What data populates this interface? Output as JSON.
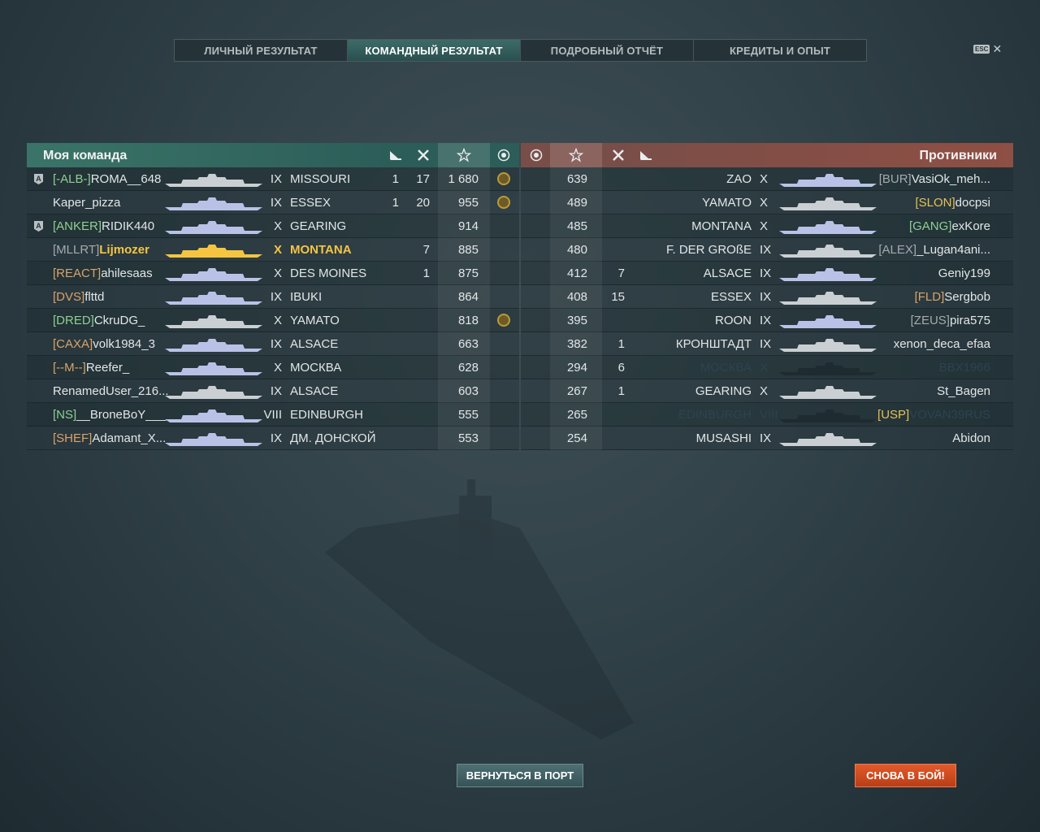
{
  "tabs": [
    "ЛИЧНЫЙ РЕЗУЛЬТАТ",
    "КОМАНДНЫЙ РЕЗУЛЬТАТ",
    "ПОДРОБНЫЙ ОТЧЁТ",
    "КРЕДИТЫ И ОПЫТ"
  ],
  "active_tab": 1,
  "esc": {
    "key": "ESC",
    "close": "✕"
  },
  "my_team": {
    "title": "Моя команда",
    "rows": [
      {
        "clan": "[-ALB-]",
        "name": "ROMA__648",
        "tier": "IX",
        "ship": "MISSOURI",
        "planes": "1",
        "kills": "17",
        "score": "1 680",
        "medal": true,
        "badge": true,
        "clan_color": "green"
      },
      {
        "clan": "",
        "name": "Kaper_pizza",
        "tier": "IX",
        "ship": "ESSEX",
        "planes": "1",
        "kills": "20",
        "score": "955",
        "medal": true,
        "badge": false,
        "clan_color": ""
      },
      {
        "clan": "[ANKER]",
        "name": "RIDIK440",
        "tier": "X",
        "ship": "GEARING",
        "planes": "",
        "kills": "",
        "score": "914",
        "medal": false,
        "badge": true,
        "clan_color": "green"
      },
      {
        "clan": "[MLLRT]",
        "name": "Lijmozer",
        "tier": "X",
        "ship": "MONTANA",
        "planes": "",
        "kills": "7",
        "score": "885",
        "medal": false,
        "badge": false,
        "clan_color": "gray",
        "me": true
      },
      {
        "clan": "[REACT]",
        "name": "ahilesaas",
        "tier": "X",
        "ship": "DES MOINES",
        "planes": "",
        "kills": "1",
        "score": "875",
        "medal": false,
        "badge": false,
        "clan_color": "orange"
      },
      {
        "clan": "[DVS]",
        "name": "flttd",
        "tier": "IX",
        "ship": "IBUKI",
        "planes": "",
        "kills": "",
        "score": "864",
        "medal": false,
        "badge": false,
        "clan_color": "orange"
      },
      {
        "clan": "[DRED]",
        "name": "CkruDG_",
        "tier": "X",
        "ship": "YAMATO",
        "planes": "",
        "kills": "",
        "score": "818",
        "medal": true,
        "badge": false,
        "clan_color": "green"
      },
      {
        "clan": "[CAXA]",
        "name": "volk1984_3",
        "tier": "IX",
        "ship": "ALSACE",
        "planes": "",
        "kills": "",
        "score": "663",
        "medal": false,
        "badge": false,
        "clan_color": "orange"
      },
      {
        "clan": "[--M--]",
        "name": "Reefer_",
        "tier": "X",
        "ship": "МОСКВА",
        "planes": "",
        "kills": "",
        "score": "628",
        "medal": false,
        "badge": false,
        "clan_color": "orange"
      },
      {
        "clan": "",
        "name": "RenamedUser_216...",
        "tier": "IX",
        "ship": "ALSACE",
        "planes": "",
        "kills": "",
        "score": "603",
        "medal": false,
        "badge": false,
        "clan_color": ""
      },
      {
        "clan": "[NS]",
        "name": "__BroneBoY___",
        "tier": "VIII",
        "ship": "EDINBURGH",
        "planes": "",
        "kills": "",
        "score": "555",
        "medal": false,
        "badge": false,
        "clan_color": "green"
      },
      {
        "clan": "[SHEF]",
        "name": "Adamant_X...",
        "tier": "IX",
        "ship": "ДМ. ДОНСКОЙ",
        "planes": "",
        "kills": "",
        "score": "553",
        "medal": false,
        "badge": false,
        "clan_color": "orange"
      }
    ]
  },
  "enemies": {
    "title": "Противники",
    "rows": [
      {
        "score": "639",
        "kills": "",
        "ship": "ZAO",
        "tier": "X",
        "clan": "[BUR]",
        "name": "VasiOk_meh...",
        "clan_color": "gray"
      },
      {
        "score": "489",
        "kills": "",
        "ship": "YAMATO",
        "tier": "X",
        "clan": "[SLON]",
        "name": "docpsi",
        "clan_color": "yellow"
      },
      {
        "score": "485",
        "kills": "",
        "ship": "MONTANA",
        "tier": "X",
        "clan": "[GANG]",
        "name": "exKore",
        "clan_color": "green"
      },
      {
        "score": "480",
        "kills": "",
        "ship": "F. DER GROßE",
        "tier": "IX",
        "clan": "[ALEX]",
        "name": "_Lugan4ani...",
        "clan_color": "gray"
      },
      {
        "score": "412",
        "kills": "7",
        "ship": "ALSACE",
        "tier": "IX",
        "clan": "",
        "name": "Geniy199",
        "clan_color": ""
      },
      {
        "score": "408",
        "kills": "15",
        "ship": "ESSEX",
        "tier": "IX",
        "clan": "[FLD]",
        "name": "Sergbob",
        "clan_color": "orange"
      },
      {
        "score": "395",
        "kills": "",
        "ship": "ROON",
        "tier": "IX",
        "clan": "[ZEUS]",
        "name": "pira575",
        "clan_color": "gray"
      },
      {
        "score": "382",
        "kills": "1",
        "ship": "КРОНШТАДТ",
        "tier": "IX",
        "clan": "",
        "name": "xenon_deca_efaa",
        "clan_color": ""
      },
      {
        "score": "294",
        "kills": "6",
        "ship": "МОСКВА",
        "tier": "X",
        "clan": "",
        "name": "BBX1966",
        "clan_color": "",
        "dead": true
      },
      {
        "score": "267",
        "kills": "1",
        "ship": "GEARING",
        "tier": "X",
        "clan": "",
        "name": "St_Bagen",
        "clan_color": ""
      },
      {
        "score": "265",
        "kills": "",
        "ship": "EDINBURGH",
        "tier": "VIII",
        "clan": "[USP]",
        "name": "VOVAN39RUS",
        "clan_color": "yellow",
        "dead": true
      },
      {
        "score": "254",
        "kills": "",
        "ship": "MUSASHI",
        "tier": "IX",
        "clan": "",
        "name": "Abidon",
        "clan_color": ""
      }
    ]
  },
  "buttons": {
    "port": "ВЕРНУТЬСЯ В ПОРТ",
    "battle": "СНОВА В БОЙ!"
  },
  "colors": {
    "ally_header": "#3a7468",
    "enemy_header": "#8e4f44",
    "player_highlight": "#f5c542",
    "battle_button": "#d24a20"
  },
  "icons": {
    "planes": "plane-icon",
    "kills": "crossed-swords-icon",
    "score": "star-icon",
    "medal": "medal-icon",
    "badge": "rank-badge-icon"
  }
}
